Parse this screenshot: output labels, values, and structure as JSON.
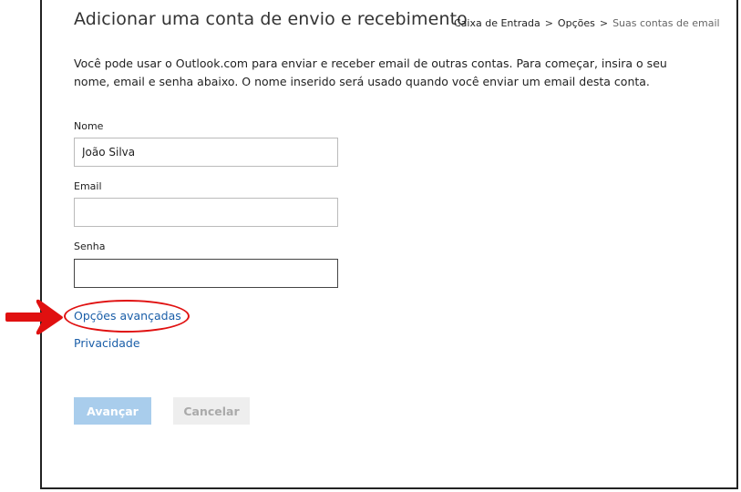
{
  "header": {
    "title": "Adicionar uma conta de envio e recebimento",
    "breadcrumb": [
      {
        "label": "Caixa de Entrada"
      },
      {
        "label": "Opções"
      },
      {
        "label": "Suas contas de email"
      }
    ],
    "separator": ">"
  },
  "intro_text": "Você pode usar o Outlook.com para enviar e receber email de outras contas. Para começar, insira o seu nome, email e senha abaixo. O nome inserido será usado quando você enviar um email desta conta.",
  "form": {
    "name_label": "Nome",
    "name_value": "João Silva",
    "email_label": "Email",
    "email_value": "",
    "password_label": "Senha",
    "password_value": ""
  },
  "links": {
    "advanced_options": "Opções avançadas",
    "privacy": "Privacidade"
  },
  "buttons": {
    "next": "Avançar",
    "cancel": "Cancelar"
  },
  "annotation": {
    "highlight_color": "#e01010",
    "arrow_icon": "right-arrow-icon"
  },
  "colors": {
    "link": "#1a5ea8",
    "primary_button_disabled": "#a9cdec",
    "secondary_button_disabled": "#eeeeee"
  }
}
